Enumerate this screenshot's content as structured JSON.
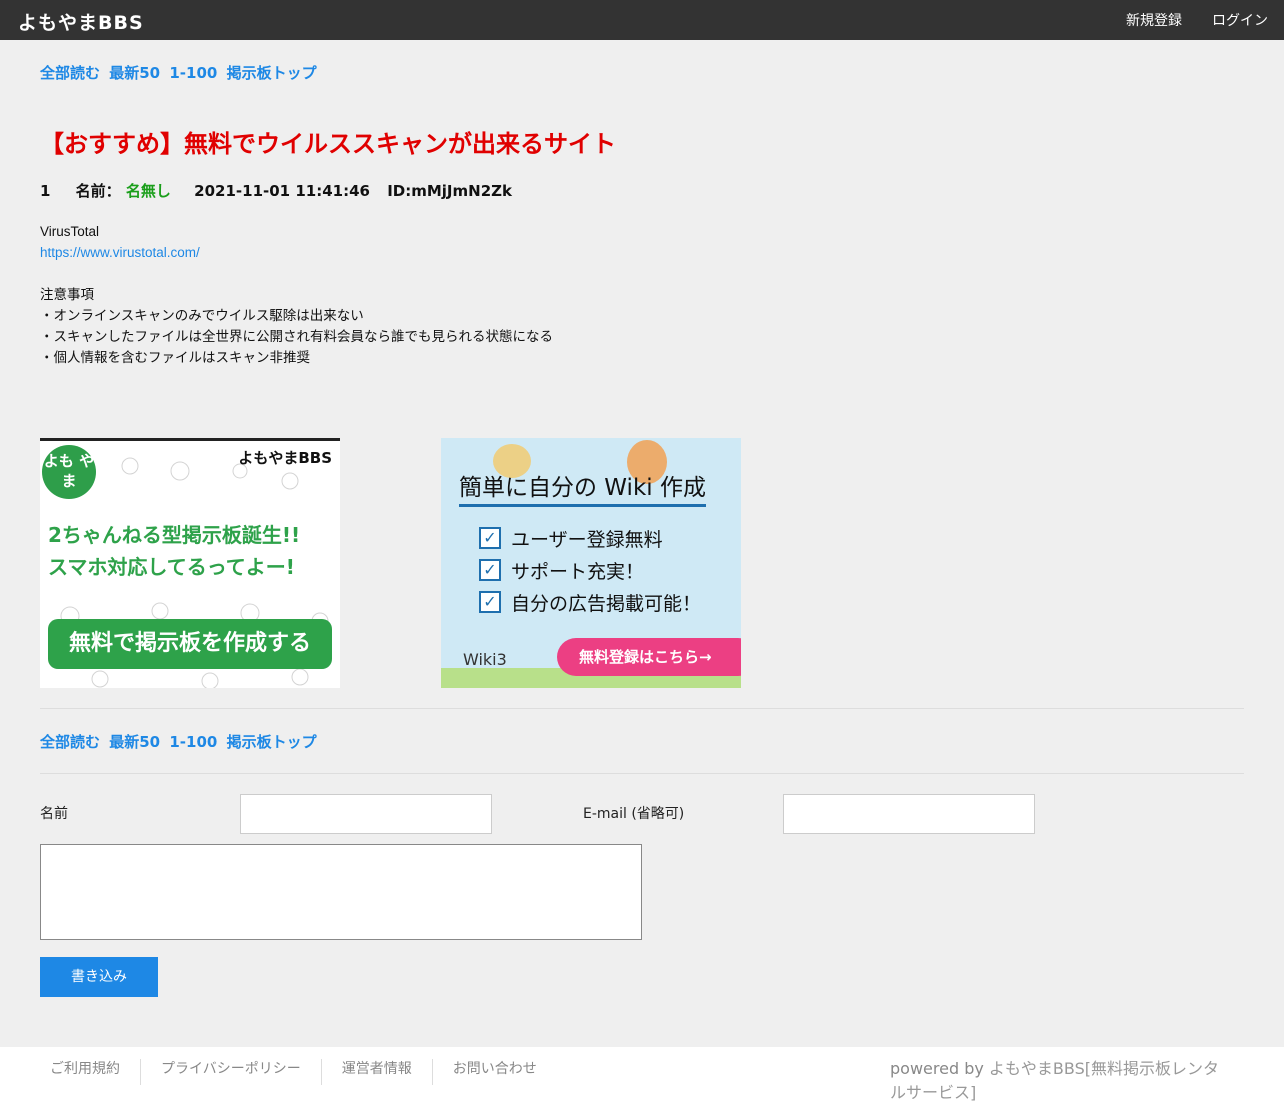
{
  "header": {
    "logo": "よもやまBBS",
    "register": "新規登録",
    "login": "ログイン"
  },
  "nav": {
    "read_all": "全部読む",
    "latest50": "最新50",
    "range": "1-100",
    "board_top": "掲示板トップ"
  },
  "thread": {
    "title": "【おすすめ】無料でウイルススキャンが出来るサイト",
    "post": {
      "number": "1",
      "name_label": "名前：",
      "name": "名無し",
      "date": "2021-11-01 11:41:46",
      "id": "ID:mMjJmN2Zk",
      "lines": {
        "l1": "VirusTotal",
        "l2": "https://www.virustotal.com/",
        "l4": "注意事項",
        "l5": "・オンラインスキャンのみでウイルス駆除は出来ない",
        "l6": "・スキャンしたファイルは全世界に公開され有料会員なら誰でも見られる状態になる",
        "l7": "・個人情報を含むファイルはスキャン非推奨"
      }
    }
  },
  "ads": {
    "left": {
      "brand": "よもやまBBS",
      "badge": "よも やま",
      "copy1": "2ちゃんねる型掲示板誕生!!",
      "copy2": "スマホ対応してるってよー!",
      "button": "無料で掲示板を作成する"
    },
    "right": {
      "title": "簡単に自分の Wiki 作成",
      "items": [
        "ユーザー登録無料",
        "サポート充実！",
        "自分の広告掲載可能！"
      ],
      "brand": "Wiki3",
      "cta": "無料登録はこちら→"
    }
  },
  "form": {
    "name_label": "名前",
    "email_label": "E-mail (省略可)",
    "submit": "書き込み"
  },
  "footer": {
    "links": [
      "ご利用規約",
      "プライバシーポリシー",
      "運営者情報",
      "お問い合わせ"
    ],
    "powered_prefix": "powered by ",
    "powered_brand": "よもやまBBS[無料掲示板レンタルサービス]"
  }
}
